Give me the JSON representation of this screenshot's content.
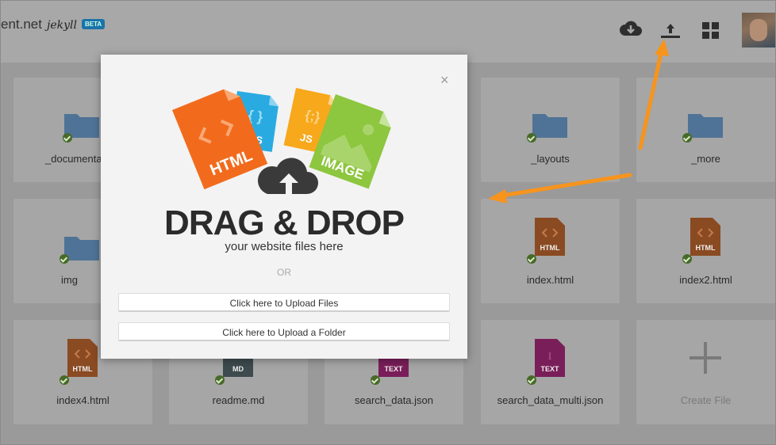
{
  "header": {
    "brand_text": "ent.net",
    "brand_script": "jekyll",
    "beta_badge": "BETA"
  },
  "icons": {
    "download": "cloud-download-icon",
    "upload": "upload-icon",
    "grid": "grid-icon",
    "avatar": "user-avatar"
  },
  "files": {
    "documentation": "_documenta",
    "layouts": "_layouts",
    "more": "_more",
    "img": "img",
    "index": "index.html",
    "index2": "index2.html",
    "index4": "index4.html",
    "readme": "readme.md",
    "search_data": "search_data.json",
    "search_data_multi": "search_data_multi.json",
    "create_file": "Create File"
  },
  "file_badges": {
    "html": "HTML",
    "md": "MD",
    "text": "TEXT"
  },
  "modal": {
    "close_symbol": "×",
    "tile_html": "HTML",
    "tile_css": "CSS",
    "tile_js": "JS",
    "tile_image": "IMAGE",
    "title": "DRAG & DROP",
    "subtitle": "your website files here",
    "or_text": "OR",
    "upload_files_label": "Click here to Upload Files",
    "upload_folder_label": "Click here to Upload a Folder"
  },
  "colors": {
    "accent_arrow": "#f7941d",
    "html_orange": "#f26b1d",
    "css_blue": "#29abe2",
    "js_yellow": "#f7a81b",
    "image_green": "#8dc63f"
  }
}
